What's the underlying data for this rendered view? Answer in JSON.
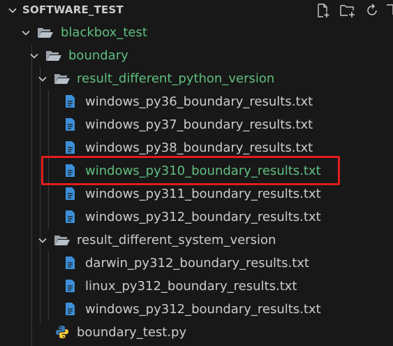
{
  "explorer": {
    "section_title": "SOFTWARE_TEST",
    "toolbar": {
      "new_file_icon": "new-file-icon",
      "new_folder_icon": "new-folder-icon",
      "refresh_icon": "refresh-icon"
    },
    "tree": {
      "blackbox_test": "blackbox_test",
      "boundary": "boundary",
      "result_python": {
        "label": "result_different_python_version",
        "files": [
          "windows_py36_boundary_results.txt",
          "windows_py37_boundary_results.txt",
          "windows_py38_boundary_results.txt",
          "windows_py310_boundary_results.txt",
          "windows_py311_boundary_results.txt",
          "windows_py312_boundary_results.txt"
        ]
      },
      "result_system": {
        "label": "result_different_system_version",
        "files": [
          "darwin_py312_boundary_results.txt",
          "linux_py312_boundary_results.txt",
          "windows_py312_boundary_results.txt"
        ]
      },
      "boundary_test_file": "boundary_test.py"
    }
  },
  "colors": {
    "background": "#181818",
    "folder_text": "#5fbf7f",
    "file_text": "#cccccc",
    "file_icon": "#3c8fd8",
    "highlight": "#e21d1d"
  }
}
